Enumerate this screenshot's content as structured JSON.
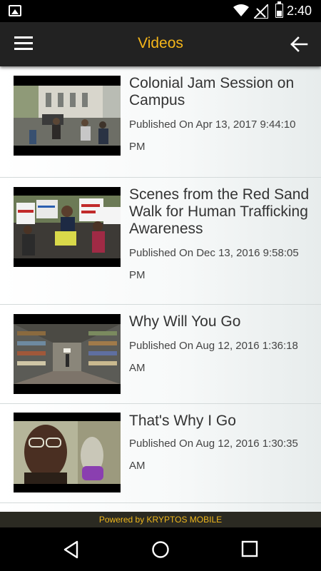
{
  "status_bar": {
    "time": "2:40"
  },
  "app_bar": {
    "title": "Videos"
  },
  "videos": [
    {
      "title": "Colonial Jam Session on Campus",
      "published": "Published On Apr 13, 2017 9:44:10 PM"
    },
    {
      "title": "Scenes from the Red Sand Walk for Human Trafficking Awareness",
      "published": "Published On Dec 13, 2016 9:58:05 PM"
    },
    {
      "title": "Why Will You Go",
      "published": "Published On Aug 12, 2016 1:36:18 AM"
    },
    {
      "title": "That's Why I Go",
      "published": "Published On Aug 12, 2016 1:30:35 AM"
    }
  ],
  "footer": {
    "text": "Powered by KRYPTOS MOBILE"
  },
  "colors": {
    "accent": "#f5b61a",
    "app_bar": "#222222",
    "footer_text": "#f0b81c"
  }
}
